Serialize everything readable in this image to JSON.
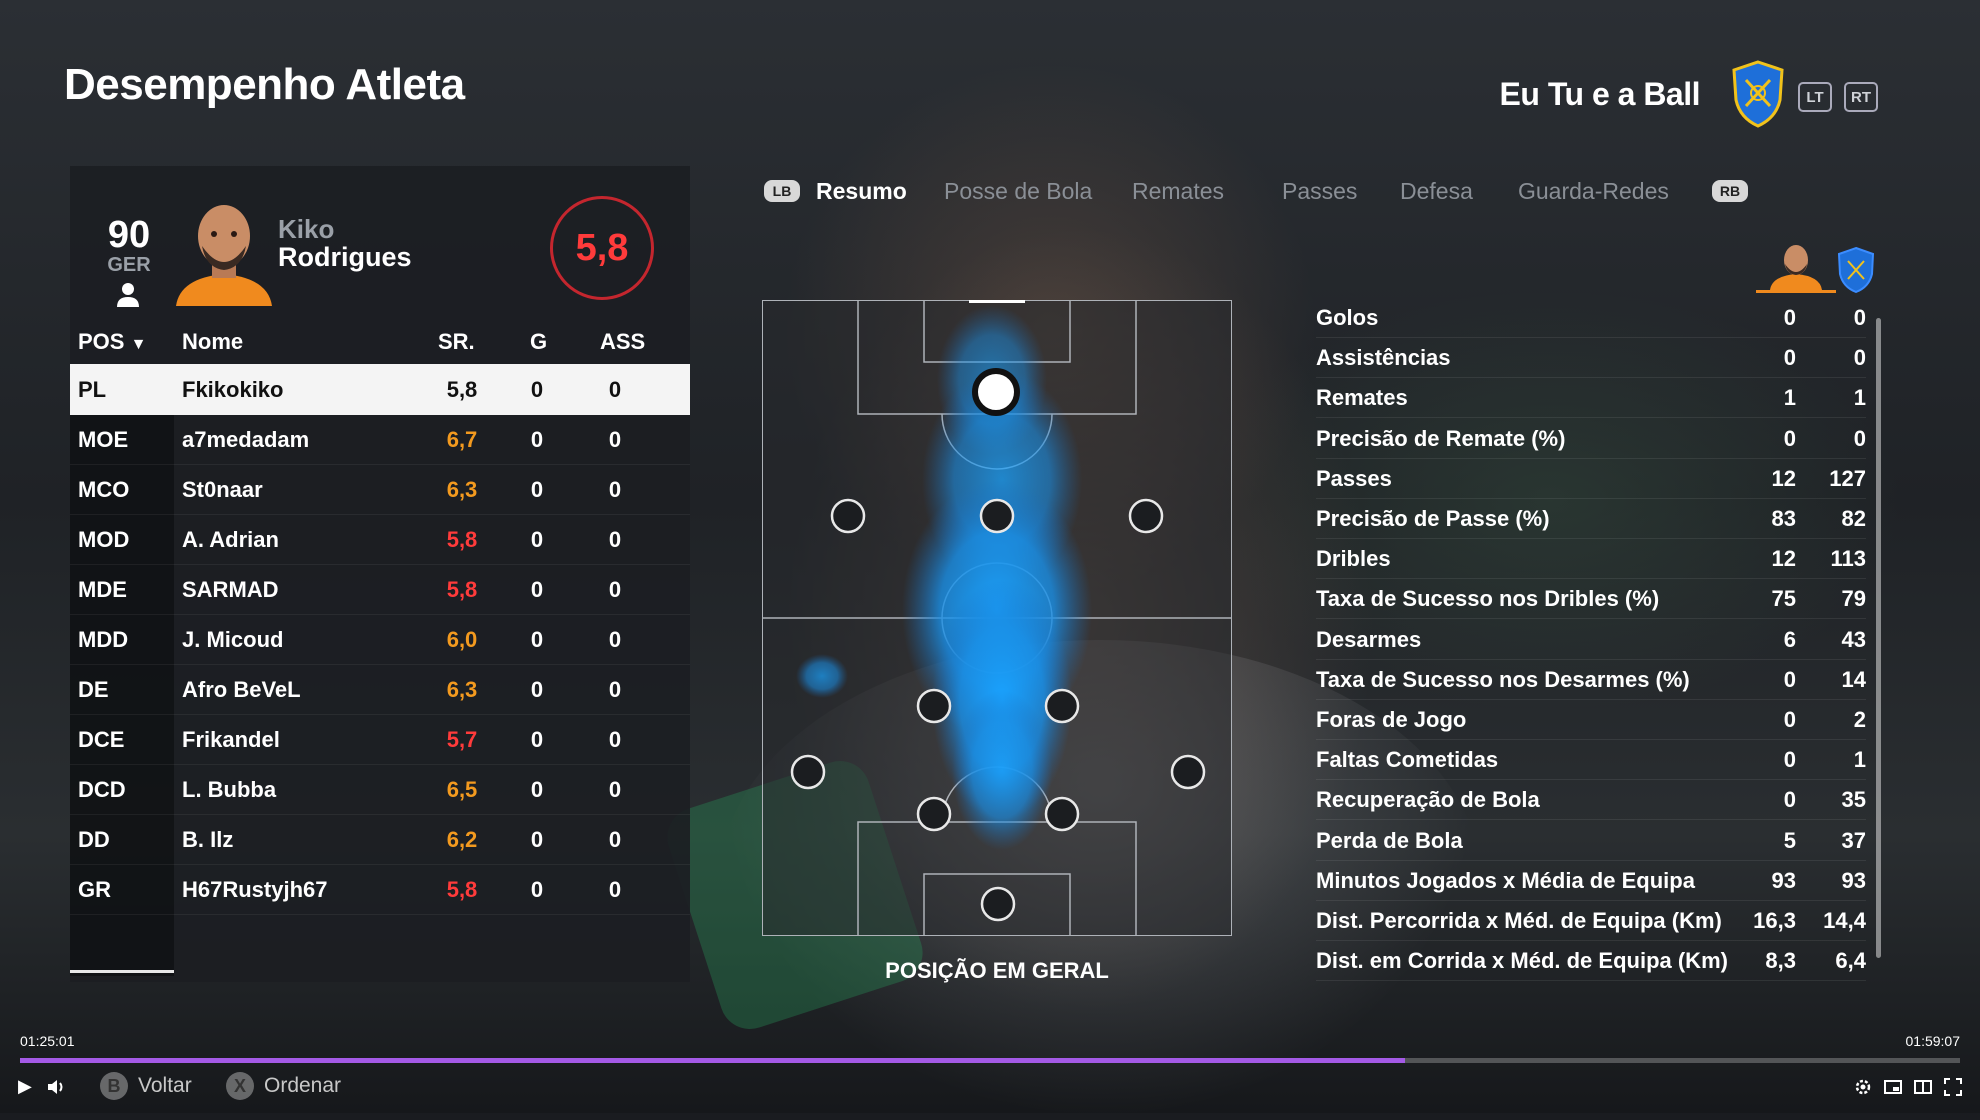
{
  "header": {
    "title": "Desempenho Atleta",
    "club_name": "Eu Tu e a Ball",
    "lt": "LT",
    "rt": "RT"
  },
  "player_card": {
    "overall": "90",
    "nation": "GER",
    "first_name": "Kiko",
    "last_name": "Rodrigues",
    "rating": "5,8"
  },
  "table": {
    "headers": {
      "pos": "POS",
      "name": "Nome",
      "sr": "SR.",
      "g": "G",
      "ass": "ASS"
    },
    "rows": [
      {
        "pos": "PL",
        "name": "Fkikokiko",
        "sr": "5,8",
        "g": "0",
        "ass": "0",
        "color": "#111111"
      },
      {
        "pos": "MOE",
        "name": "a7medadam",
        "sr": "6,7",
        "g": "0",
        "ass": "0",
        "color": "#f39a1f"
      },
      {
        "pos": "MCO",
        "name": "St0naar",
        "sr": "6,3",
        "g": "0",
        "ass": "0",
        "color": "#f39a1f"
      },
      {
        "pos": "MOD",
        "name": "A. Adrian",
        "sr": "5,8",
        "g": "0",
        "ass": "0",
        "color": "#ff3b3b"
      },
      {
        "pos": "MDE",
        "name": "SARMAD",
        "sr": "5,8",
        "g": "0",
        "ass": "0",
        "color": "#ff3b3b"
      },
      {
        "pos": "MDD",
        "name": "J. Micoud",
        "sr": "6,0",
        "g": "0",
        "ass": "0",
        "color": "#f39a1f"
      },
      {
        "pos": "DE",
        "name": "Afro BeVeL",
        "sr": "6,3",
        "g": "0",
        "ass": "0",
        "color": "#f39a1f"
      },
      {
        "pos": "DCE",
        "name": "Frikandel",
        "sr": "5,7",
        "g": "0",
        "ass": "0",
        "color": "#ff3b3b"
      },
      {
        "pos": "DCD",
        "name": "L. Bubba",
        "sr": "6,5",
        "g": "0",
        "ass": "0",
        "color": "#f39a1f"
      },
      {
        "pos": "DD",
        "name": "B. Ilz",
        "sr": "6,2",
        "g": "0",
        "ass": "0",
        "color": "#f39a1f"
      },
      {
        "pos": "GR",
        "name": "H67Rustyjh67",
        "sr": "5,8",
        "g": "0",
        "ass": "0",
        "color": "#ff3b3b"
      }
    ]
  },
  "tabs": {
    "lb": "LB",
    "rb": "RB",
    "items": [
      "Resumo",
      "Posse de Bola",
      "Remates",
      "Passes",
      "Defesa",
      "Guarda-Redes"
    ],
    "active_index": 0
  },
  "pitch": {
    "caption": "POSIÇÃO EM GERAL"
  },
  "stats": [
    {
      "label": "Golos",
      "player": "0",
      "team": "0"
    },
    {
      "label": "Assistências",
      "player": "0",
      "team": "0"
    },
    {
      "label": "Remates",
      "player": "1",
      "team": "1"
    },
    {
      "label": "Precisão de Remate (%)",
      "player": "0",
      "team": "0"
    },
    {
      "label": "Passes",
      "player": "12",
      "team": "127"
    },
    {
      "label": "Precisão de Passe (%)",
      "player": "83",
      "team": "82"
    },
    {
      "label": "Dribles",
      "player": "12",
      "team": "113"
    },
    {
      "label": "Taxa de Sucesso nos Dribles (%)",
      "player": "75",
      "team": "79"
    },
    {
      "label": "Desarmes",
      "player": "6",
      "team": "43"
    },
    {
      "label": "Taxa de Sucesso nos Desarmes (%)",
      "player": "0",
      "team": "14"
    },
    {
      "label": "Foras de Jogo",
      "player": "0",
      "team": "2"
    },
    {
      "label": "Faltas Cometidas",
      "player": "0",
      "team": "1"
    },
    {
      "label": "Recuperação de Bola",
      "player": "0",
      "team": "35"
    },
    {
      "label": "Perda de Bola",
      "player": "5",
      "team": "37"
    },
    {
      "label": "Minutos Jogados x Média de Equipa",
      "player": "93",
      "team": "93"
    },
    {
      "label": "Dist. Percorrida x Méd. de Equipa (Km)",
      "player": "16,3",
      "team": "14,4"
    },
    {
      "label": "Dist. em Corrida x Méd. de Equipa (Km)",
      "player": "8,3",
      "team": "6,4"
    }
  ],
  "footer": {
    "back_button": "B",
    "back_label": "Voltar",
    "sort_button": "X",
    "sort_label": "Ordenar"
  },
  "player_bar": {
    "elapsed": "01:25:01",
    "total": "01:59:07",
    "progress": 0.7138
  },
  "colors": {
    "accent": "#a45ae6",
    "rating_red": "#ff3b3b",
    "rating_orange": "#f39a1f",
    "heat_blue": "#1aa3ff"
  }
}
